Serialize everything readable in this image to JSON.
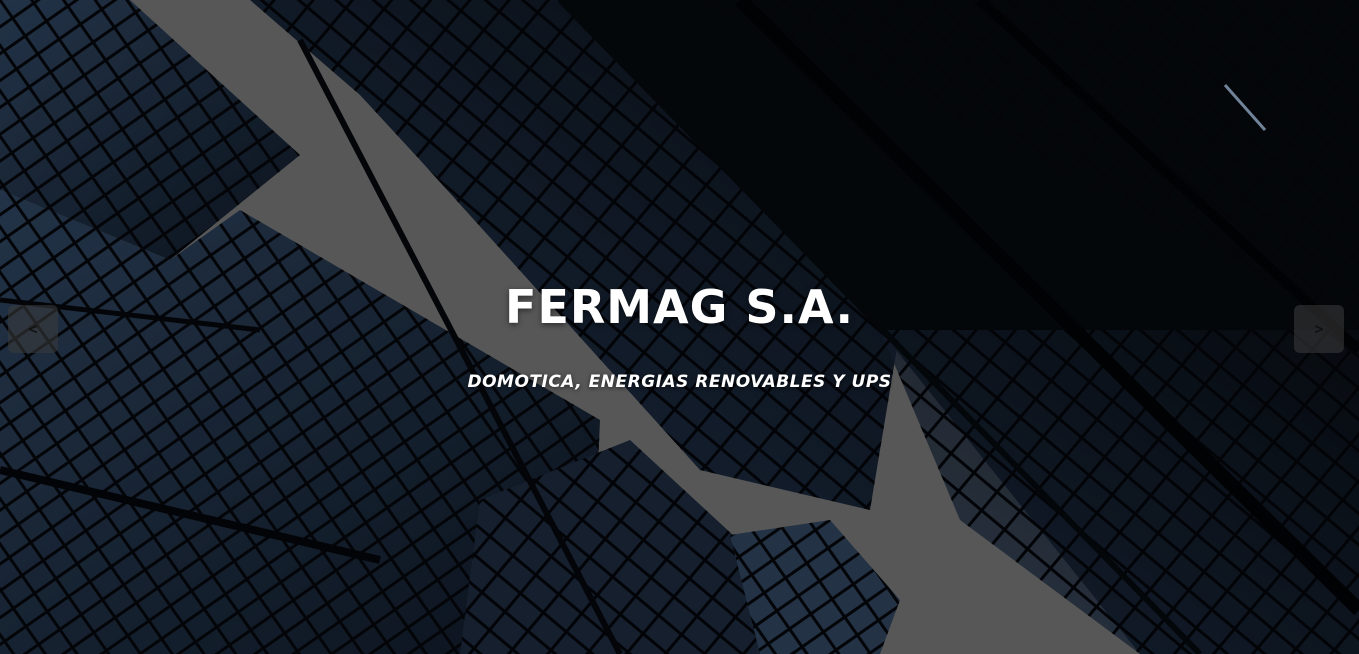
{
  "hero": {
    "title": "FERMAG S.A.",
    "subtitle": "DOMOTICA, ENERGIAS RENOVABLES Y UPS",
    "background_image": "skyscrapers-looking-up"
  },
  "carousel": {
    "prev_label": "<",
    "next_label": ">"
  },
  "colors": {
    "text": "#ffffff",
    "sky": "#6e6e6e",
    "building_glass": "#1c2b3f",
    "building_frame": "#05070a"
  }
}
